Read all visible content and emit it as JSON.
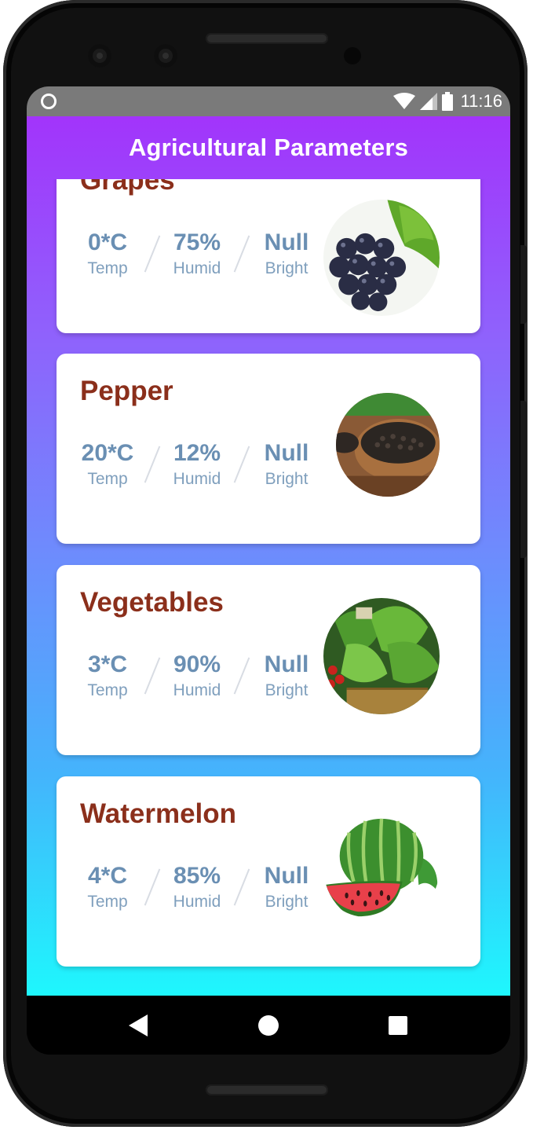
{
  "status_bar": {
    "time": "11:16",
    "icons": [
      "notification-ring-icon",
      "wifi-icon",
      "signal-icon",
      "battery-icon"
    ]
  },
  "app_bar": {
    "title": "Agricultural Parameters"
  },
  "crops": [
    {
      "name": "Grapes",
      "temp": "0*C",
      "temp_label": "Temp",
      "humid": "75%",
      "humid_label": "Humid",
      "bright": "Null",
      "bright_label": "Bright",
      "image": "grapes-image"
    },
    {
      "name": "Pepper",
      "temp": "20*C",
      "temp_label": "Temp",
      "humid": "12%",
      "humid_label": "Humid",
      "bright": "Null",
      "bright_label": "Bright",
      "image": "pepper-image"
    },
    {
      "name": "Vegetables",
      "temp": "3*C",
      "temp_label": "Temp",
      "humid": "90%",
      "humid_label": "Humid",
      "bright": "Null",
      "bright_label": "Bright",
      "image": "vegetables-image"
    },
    {
      "name": "Watermelon",
      "temp": "4*C",
      "temp_label": "Temp",
      "humid": "85%",
      "humid_label": "Humid",
      "bright": "Null",
      "bright_label": "Bright",
      "image": "watermelon-image"
    }
  ],
  "nav_bar": {
    "buttons": [
      "back-icon",
      "home-icon",
      "recents-icon"
    ]
  },
  "colors": {
    "gradient_top": "#a234fb",
    "gradient_bottom": "#1ef7fd",
    "crop_title": "#8b2f1b",
    "stat_value": "#6a8fb3",
    "card_bg": "#ffffff"
  }
}
